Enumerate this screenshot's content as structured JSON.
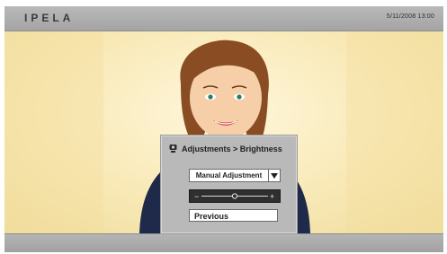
{
  "header": {
    "logo": "IPELA",
    "datetime": "5/11/2008 13:00"
  },
  "menu": {
    "title": "Adjustments > Brightness",
    "mode_select": {
      "value": "Manual Adjustment"
    },
    "brightness_slider": {
      "min_symbol": "−",
      "max_symbol": "+",
      "level": 0.5
    },
    "previous_label": "Previous"
  },
  "icons": {
    "menu_title": "camera-icon",
    "dropdown": "chevron-down-icon"
  },
  "colors": {
    "bar": "#aaaaaa",
    "video_background": "#f6e6ae",
    "menu_panel": "#b9b9b9",
    "slider_track": "#2f2f2f",
    "jacket": "#1f2a4a"
  }
}
